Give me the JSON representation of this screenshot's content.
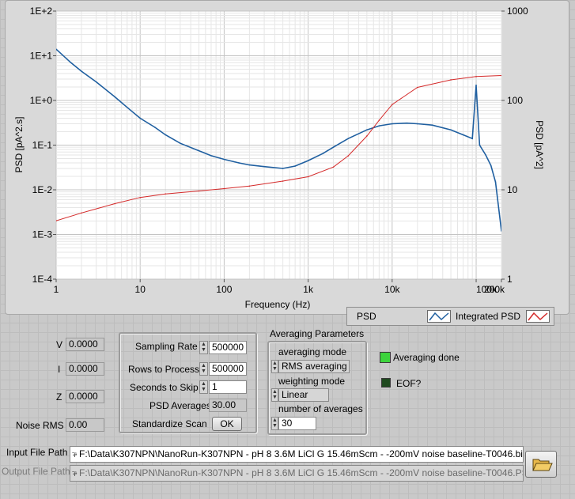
{
  "chart": {
    "left_axis_label": "PSD [pA^2.s]",
    "right_axis_label": "PSD [pA^2]",
    "x_axis_label": "Frequency (Hz)"
  },
  "chart_data": {
    "type": "line",
    "xlabel": "Frequency (Hz)",
    "ylabel": "PSD [pA^2.s]",
    "y2label": "PSD [pA^2]",
    "xscale": "log",
    "yscale": "log",
    "y2scale": "log",
    "xlim": [
      1,
      200000
    ],
    "ylim": [
      0.0001,
      100
    ],
    "y2lim": [
      1,
      1000
    ],
    "grid": true,
    "x_tick_labels": [
      "1",
      "10",
      "100",
      "1k",
      "10k",
      "100k",
      "200k"
    ],
    "y_tick_labels": [
      "1E-4",
      "1E-3",
      "1E-2",
      "1E-1",
      "1E+0",
      "1E+1",
      "1E+2"
    ],
    "y2_tick_labels": [
      "1",
      "10",
      "100",
      "1000"
    ],
    "legend_position": "bottom-right",
    "series": [
      {
        "name": "PSD",
        "axis": "left",
        "color": "#1f5fa0",
        "x": [
          1,
          1.5,
          2,
          3,
          5,
          7,
          10,
          15,
          20,
          30,
          50,
          70,
          100,
          150,
          200,
          300,
          500,
          700,
          1000,
          1500,
          2000,
          3000,
          5000,
          7000,
          10000,
          15000,
          20000,
          30000,
          50000,
          70000,
          90000,
          100000,
          110000,
          130000,
          150000,
          170000,
          200000
        ],
        "y": [
          14,
          7,
          4.5,
          2.6,
          1.2,
          0.7,
          0.4,
          0.25,
          0.17,
          0.11,
          0.075,
          0.058,
          0.048,
          0.04,
          0.036,
          0.033,
          0.03,
          0.034,
          0.045,
          0.065,
          0.09,
          0.14,
          0.22,
          0.27,
          0.3,
          0.31,
          0.3,
          0.28,
          0.22,
          0.17,
          0.14,
          2.2,
          0.1,
          0.06,
          0.035,
          0.015,
          0.0012
        ]
      },
      {
        "name": "Integrated PSD",
        "axis": "right",
        "color": "#d42a2a",
        "x": [
          1,
          2,
          5,
          10,
          20,
          50,
          100,
          200,
          500,
          1000,
          2000,
          3000,
          5000,
          7000,
          10000,
          20000,
          50000,
          100000,
          200000
        ],
        "y": [
          4.5,
          5.5,
          7,
          8.2,
          9,
          9.7,
          10.3,
          11,
          12.5,
          14,
          18,
          24,
          40,
          60,
          90,
          140,
          170,
          185,
          190
        ]
      }
    ]
  },
  "legend": {
    "psd_label": "PSD",
    "integrated_label": "Integrated PSD"
  },
  "left_panel": {
    "v_label": "V",
    "v_value": "0.0000",
    "i_label": "I",
    "i_value": "0.0000",
    "z_label": "Z",
    "z_value": "0.0000",
    "noise_label": "Noise RMS",
    "noise_value": "0.00"
  },
  "mid_panel": {
    "sampling_rate_label": "Sampling Rate",
    "sampling_rate_value": "500000",
    "rows_label": "Rows to Process",
    "rows_value": "500000",
    "skip_label": "Seconds to Skip",
    "skip_value": "1",
    "psd_avg_label": "PSD Averages",
    "psd_avg_value": "30.00",
    "standardize_label": "Standardize Scan",
    "ok_label": "OK"
  },
  "averaging": {
    "title": "Averaging Parameters",
    "mode_label": "averaging mode",
    "mode_value": "RMS averaging",
    "weighting_label": "weighting mode",
    "weighting_value": "Linear",
    "number_label": "number of averages",
    "number_value": "30"
  },
  "indicators": {
    "done_label": "Averaging done",
    "done_color": "#3cd43c",
    "eof_label": "EOF?",
    "eof_color": "#1f4a1f"
  },
  "files": {
    "input_label": "Input File Path",
    "input_value": "F:\\Data\\K307NPN\\NanoRun-K307NPN - pH 8 3.6M LiCl G 15.46mScm - -200mV noise baseline-T0046.bin",
    "output_label": "Output File Path",
    "output_value": "F:\\Data\\K307NPN\\NanoRun-K307NPN - pH 8 3.6M LiCl G 15.46mScm - -200mV noise baseline-T0046.PSD"
  }
}
